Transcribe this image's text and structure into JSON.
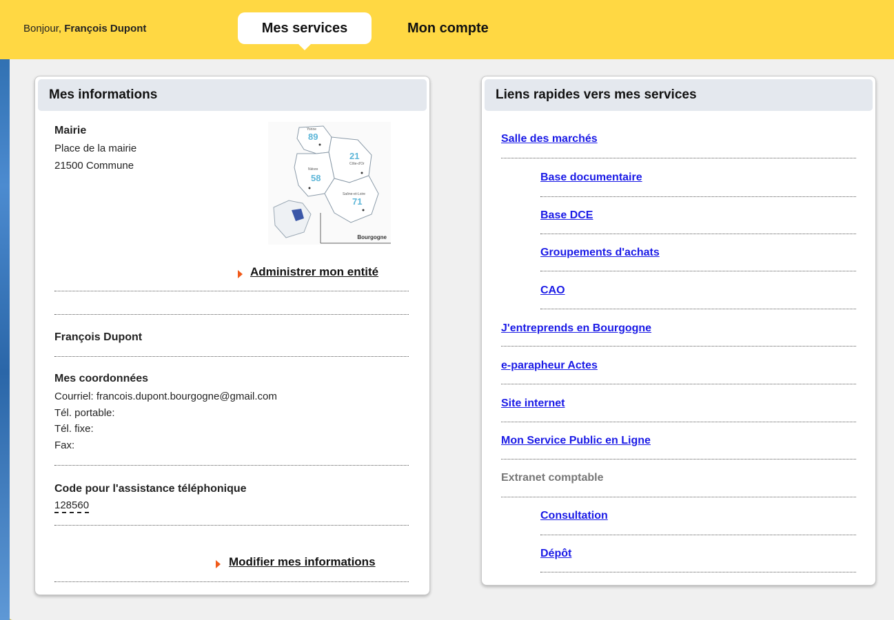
{
  "header": {
    "greeting_prefix": "Bonjour,",
    "user_name": "François Dupont",
    "tabs": [
      {
        "label": "Mes services",
        "active": true
      },
      {
        "label": "Mon compte",
        "active": false
      }
    ]
  },
  "info_panel": {
    "title": "Mes informations",
    "entity": {
      "name": "Mairie",
      "address_line1": "Place de la mairie",
      "address_line2": "21500 Commune"
    },
    "map": {
      "region_label": "Bourgogne",
      "departments": [
        "89",
        "21",
        "58",
        "71"
      ],
      "city_labels": [
        "Yonne",
        "Côte-d'Or",
        "Nièvre",
        "Saône-et-Loire"
      ]
    },
    "admin_link": "Administrer mon entité",
    "person_name": "François Dupont",
    "contact": {
      "heading": "Mes coordonnées",
      "email_line": "Courriel: francois.dupont.bourgogne@gmail.com",
      "mobile_line": "Tél. portable:",
      "phone_line": "Tél. fixe:",
      "fax_line": "Fax:"
    },
    "support": {
      "heading": "Code pour l'assistance téléphonique",
      "code": "128560"
    },
    "edit_link": "Modifier mes informations"
  },
  "links_panel": {
    "title": "Liens rapides vers mes services",
    "items": [
      {
        "label": "Salle des marchés",
        "level": 0,
        "link": true
      },
      {
        "label": "Base documentaire",
        "level": 1,
        "link": true
      },
      {
        "label": "Base DCE",
        "level": 1,
        "link": true
      },
      {
        "label": "Groupements d'achats",
        "level": 1,
        "link": true
      },
      {
        "label": "CAO",
        "level": 1,
        "link": true
      },
      {
        "label": "J'entreprends en Bourgogne",
        "level": 0,
        "link": true
      },
      {
        "label": "e-parapheur Actes",
        "level": 0,
        "link": true
      },
      {
        "label": "Site internet",
        "level": 0,
        "link": true
      },
      {
        "label": "Mon Service Public en Ligne",
        "level": 0,
        "link": true
      },
      {
        "label": "Extranet comptable",
        "level": 0,
        "link": false
      },
      {
        "label": "Consultation",
        "level": 1,
        "link": true
      },
      {
        "label": "Dépôt",
        "level": 1,
        "link": true
      }
    ]
  },
  "colors": {
    "header_yellow": "#ffd843",
    "link_blue": "#1a1ae6",
    "arrow_orange": "#f05a1a",
    "panel_head": "#e4e8ee"
  }
}
